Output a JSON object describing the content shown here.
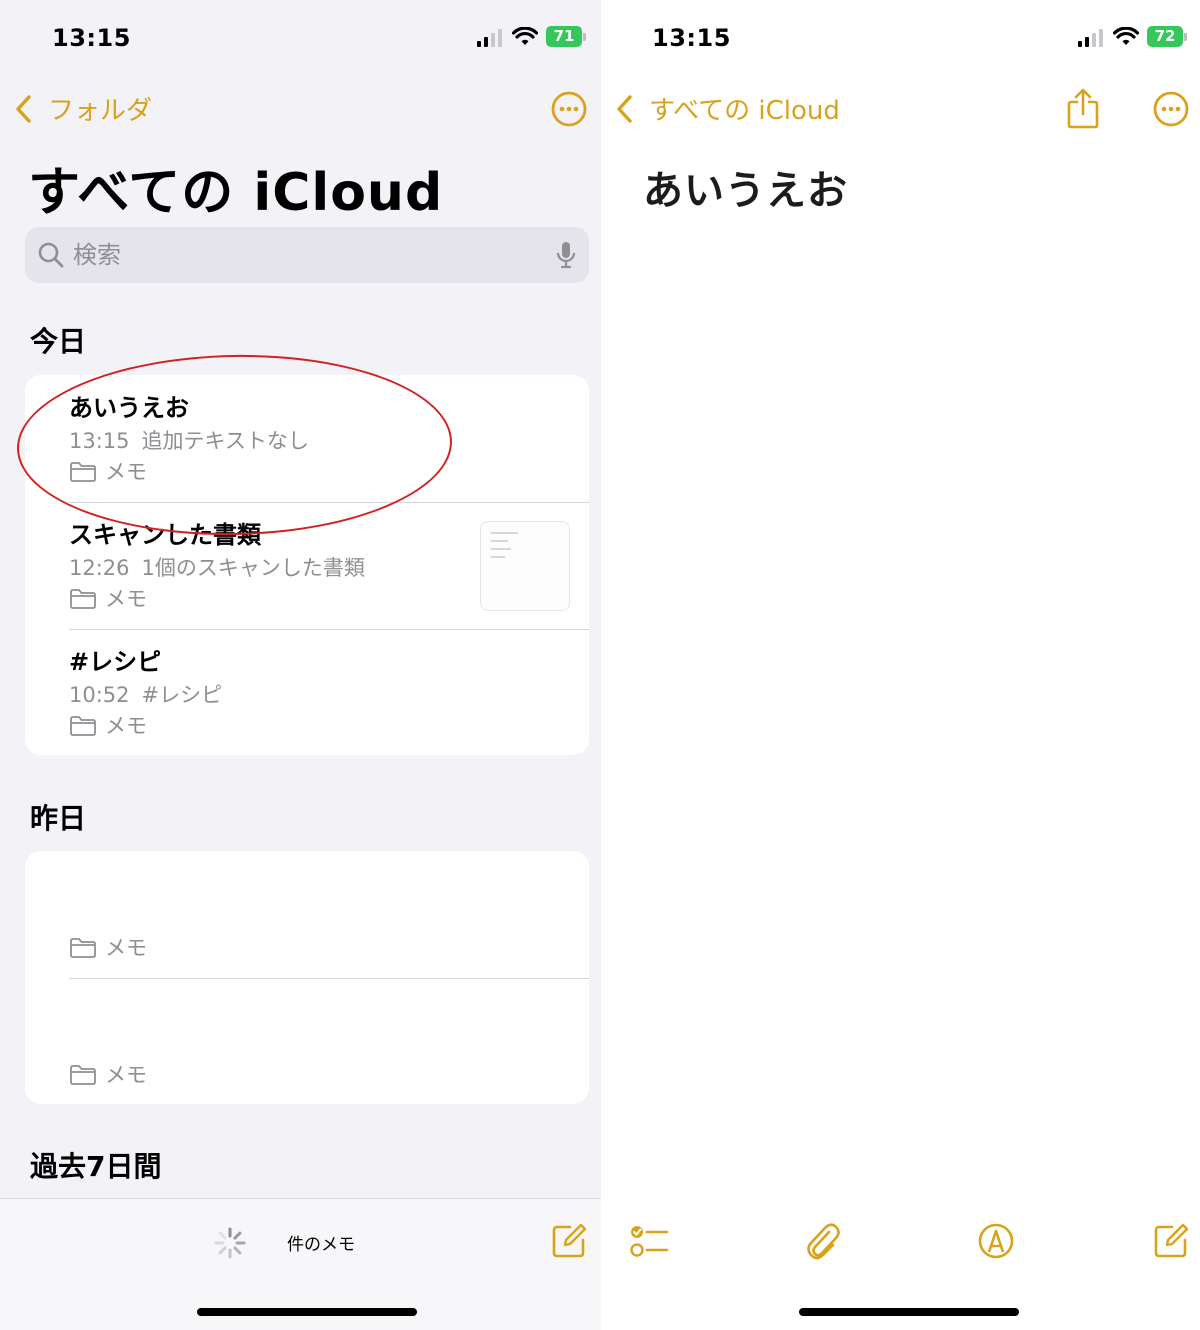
{
  "left": {
    "status": {
      "time": "13:15",
      "battery": "71"
    },
    "nav": {
      "back_label": "フォルダ"
    },
    "title": "すべての iCloud",
    "search": {
      "placeholder": "検索"
    },
    "sections": {
      "today": "今日",
      "yesterday": "昨日",
      "past7": "過去7日間"
    },
    "today_notes": [
      {
        "title": "あいうえお",
        "time": "13:15",
        "preview": "追加テキストなし",
        "folder": "メモ"
      },
      {
        "title": "スキャンした書類",
        "time": "12:26",
        "preview": "1個のスキャンした書類",
        "folder": "メモ"
      },
      {
        "title": "#レシピ",
        "time": "10:52",
        "preview": "#レシピ",
        "folder": "メモ"
      }
    ],
    "yesterday_notes": [
      {
        "title": "",
        "time": "",
        "preview": "",
        "folder": "メモ"
      },
      {
        "title": "",
        "time": "",
        "preview": "",
        "folder": "メモ"
      }
    ],
    "bottom": {
      "count_label": "件のメモ"
    }
  },
  "right": {
    "status": {
      "time": "13:15",
      "battery": "72"
    },
    "nav": {
      "back_label": "すべての iCloud"
    },
    "note_title": "あいうえお"
  },
  "colors": {
    "accent": "#d9a21b",
    "annotation": "#d32020",
    "battery": "#34c759"
  },
  "icons": [
    "chevron-left-icon",
    "ellipsis-circle-icon",
    "search-icon",
    "microphone-icon",
    "folder-icon",
    "spinner-icon",
    "compose-icon",
    "share-icon",
    "checklist-icon",
    "paperclip-icon",
    "markup-icon",
    "signal-icon",
    "wifi-icon",
    "battery-icon"
  ]
}
